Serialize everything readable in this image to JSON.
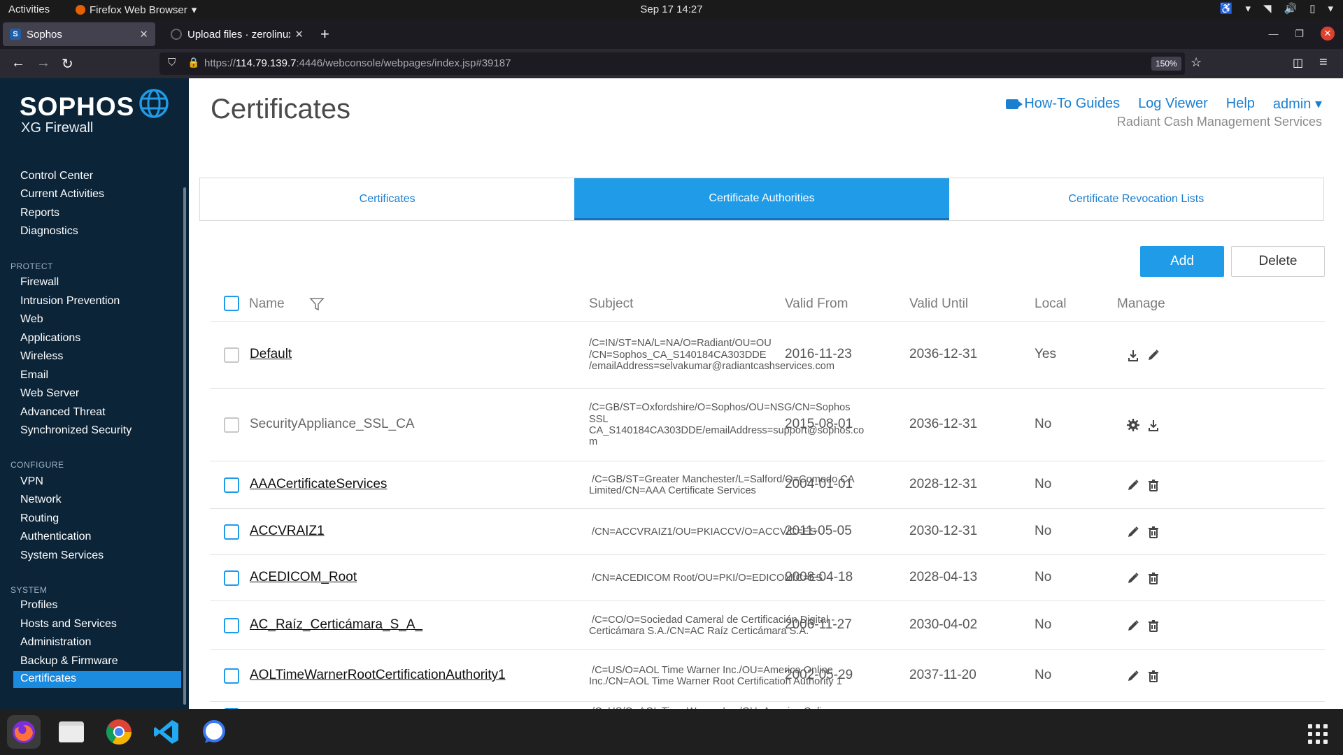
{
  "topbar": {
    "activities": "Activities",
    "app_name": "Firefox Web Browser",
    "clock": "Sep 17  14:27"
  },
  "browser": {
    "tabs": [
      {
        "title": "Sophos",
        "favicon": "S"
      },
      {
        "title": "Upload files · zerolinuxes",
        "favicon": ""
      }
    ],
    "url_prefix": "https://",
    "url_host": "114.79.139.7",
    "url_rest": ":4446/webconsole/webpages/index.jsp#39187",
    "zoom": "150%"
  },
  "sidebar": {
    "brand": "SOPHOS",
    "product": "XG Firewall",
    "top_items": [
      "Control Center",
      "Current Activities",
      "Reports",
      "Diagnostics"
    ],
    "sections": [
      {
        "title": "PROTECT",
        "items": [
          "Firewall",
          "Intrusion Prevention",
          "Web",
          "Applications",
          "Wireless",
          "Email",
          "Web Server",
          "Advanced Threat",
          "Synchronized Security"
        ]
      },
      {
        "title": "CONFIGURE",
        "items": [
          "VPN",
          "Network",
          "Routing",
          "Authentication",
          "System Services"
        ]
      },
      {
        "title": "SYSTEM",
        "items": [
          "Profiles",
          "Hosts and Services",
          "Administration",
          "Backup & Firmware",
          "Certificates"
        ]
      }
    ],
    "active": "Certificates"
  },
  "header": {
    "title": "Certificates",
    "links": {
      "howto": "How-To Guides",
      "log_viewer": "Log Viewer",
      "help": "Help",
      "user": "admin"
    },
    "organization": "Radiant Cash Management Services"
  },
  "page_tabs": [
    "Certificates",
    "Certificate Authorities",
    "Certificate Revocation Lists"
  ],
  "selected_tab": "Certificate Authorities",
  "buttons": {
    "add": "Add",
    "delete": "Delete"
  },
  "table": {
    "columns": {
      "name": "Name",
      "subject": "Subject",
      "valid_from": "Valid From",
      "valid_until": "Valid Until",
      "local": "Local",
      "manage": "Manage"
    },
    "rows": [
      {
        "name": "Default",
        "subject": "/C=IN/ST=NA/L=NA/O=Radiant/OU=OU\n/CN=Sophos_CA_S140184CA303DDE\n/emailAddress=selvakumar@radiantcashservices.com",
        "valid_from": "2016-11-23",
        "valid_until": "2036-12-31",
        "local": "Yes",
        "actions": [
          "download-icon",
          "edit-icon"
        ]
      },
      {
        "name": "SecurityAppliance_SSL_CA",
        "subject": "/C=GB/ST=Oxfordshire/O=Sophos/OU=NSG/CN=Sophos\nSSL\nCA_S140184CA303DDE/emailAddress=support@sophos.co\nm",
        "valid_from": "2015-08-01",
        "valid_until": "2036-12-31",
        "local": "No",
        "actions": [
          "gear-icon",
          "download-icon"
        ]
      },
      {
        "name": "AAACertificateServices",
        "subject": " /C=GB/ST=Greater Manchester/L=Salford/O=Comodo CA\nLimited/CN=AAA Certificate Services",
        "valid_from": "2004-01-01",
        "valid_until": "2028-12-31",
        "local": "No",
        "actions": [
          "edit-icon",
          "trash-icon"
        ]
      },
      {
        "name": "ACCVRAIZ1",
        "subject": " /CN=ACCVRAIZ1/OU=PKIACCV/O=ACCV/C=ES",
        "valid_from": "2011-05-05",
        "valid_until": "2030-12-31",
        "local": "No",
        "actions": [
          "edit-icon",
          "trash-icon"
        ]
      },
      {
        "name": "ACEDICOM_Root",
        "subject": " /CN=ACEDICOM Root/OU=PKI/O=EDICOM/C=ES",
        "valid_from": "2008-04-18",
        "valid_until": "2028-04-13",
        "local": "No",
        "actions": [
          "edit-icon",
          "trash-icon"
        ]
      },
      {
        "name": "AC_Raíz_Certicámara_S_A_",
        "subject": " /C=CO/O=Sociedad Cameral de Certificación Digital -\nCerticámara S.A./CN=AC Raíz Certicámara S.A.",
        "valid_from": "2006-11-27",
        "valid_until": "2030-04-02",
        "local": "No",
        "actions": [
          "edit-icon",
          "trash-icon"
        ]
      },
      {
        "name": "AOLTimeWarnerRootCertificationAuthority1",
        "subject": " /C=US/O=AOL Time Warner Inc./OU=America Online\nInc./CN=AOL Time Warner Root Certification Authority 1",
        "valid_from": "2002-05-29",
        "valid_until": "2037-11-20",
        "local": "No",
        "actions": [
          "edit-icon",
          "trash-icon"
        ]
      },
      {
        "name": "",
        "subject": " /C=US/O=AOL Time Warner Inc./OU=America Online",
        "valid_from": "",
        "valid_until": "",
        "local": "",
        "actions": []
      }
    ]
  },
  "colors": {
    "accent": "#1f9be8",
    "sidebar_bg": "#0b2438",
    "link": "#1b7fd0"
  }
}
